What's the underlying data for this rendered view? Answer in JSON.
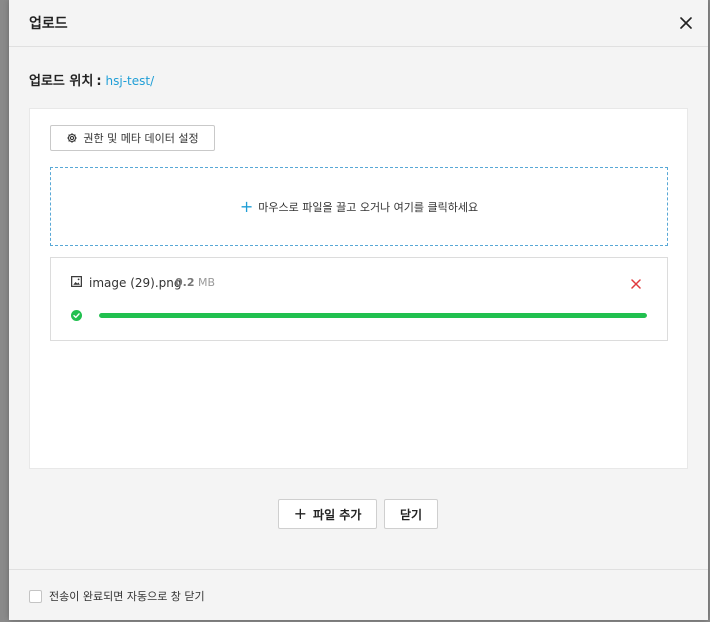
{
  "dialog": {
    "title": "업로드",
    "close_icon": "close-icon"
  },
  "location": {
    "label": "업로드 위치",
    "separator": ":",
    "path": "hsj-test/"
  },
  "toolbar": {
    "settings_label": "권한 및 메타 데이터 설정",
    "settings_icon": "gear-icon"
  },
  "dropzone": {
    "plus": "+",
    "text": "마우스로 파일을 끌고 오거나 여기를 클릭하세요"
  },
  "files": [
    {
      "name": "image (29).png",
      "size": "0.2",
      "unit": "MB",
      "status": "complete",
      "progress_percent": 100,
      "file_icon": "image-icon",
      "status_icon": "check-circle-icon",
      "remove_icon": "remove-icon"
    }
  ],
  "actions": {
    "add_plus": "+",
    "add_label": "파일 추가",
    "close_label": "닫기"
  },
  "footer": {
    "auto_close_label": "전송이 완료되면 자동으로 창 닫기",
    "auto_close_checked": false
  },
  "colors": {
    "accent": "#1f9ed6",
    "progress": "#21c04f",
    "danger": "#e0393e"
  }
}
